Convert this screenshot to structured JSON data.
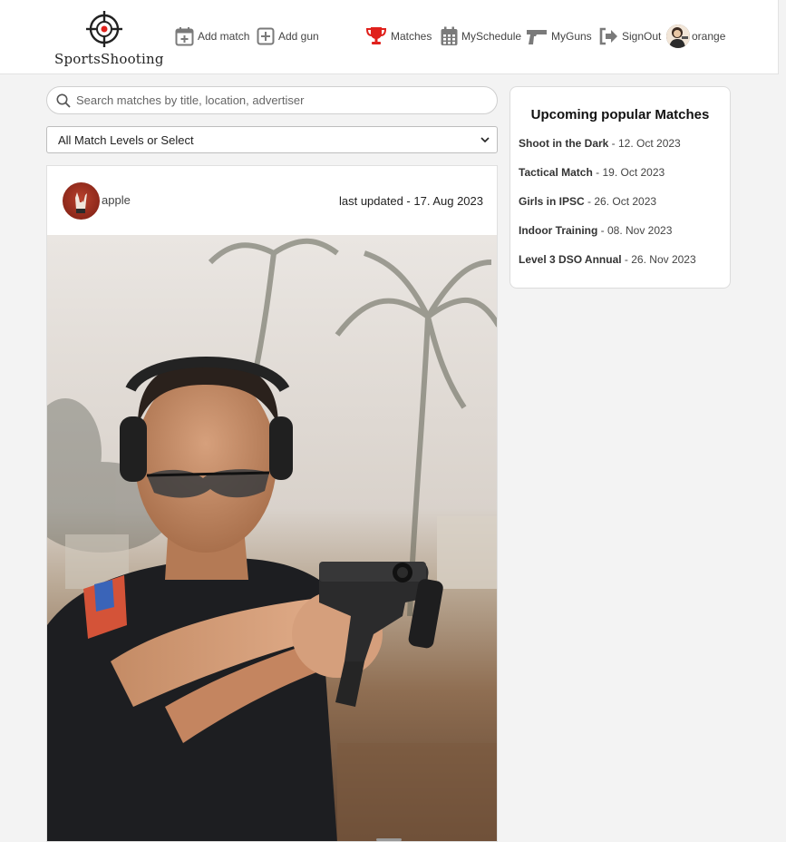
{
  "brand": {
    "name": "SportsShooting",
    "icon": "crosshair-logo"
  },
  "nav": {
    "add_match": "Add match",
    "add_gun": "Add gun",
    "matches": "Matches",
    "schedule": "MySchedule",
    "guns": "MyGuns",
    "signout": "SignOut",
    "user": "orange"
  },
  "search": {
    "placeholder": "Search matches by title, location, advertiser",
    "value": ""
  },
  "filter": {
    "selected": "All Match Levels or Select"
  },
  "post": {
    "user": "apple",
    "updated": "last updated - 17. Aug 2023"
  },
  "popular": {
    "title": "Upcoming popular Matches",
    "items": [
      {
        "name": "Shoot in the Dark",
        "date": " - 12. Oct 2023"
      },
      {
        "name": "Tactical Match",
        "date": " - 19. Oct 2023"
      },
      {
        "name": "Girls in IPSC",
        "date": " - 26. Oct 2023"
      },
      {
        "name": "Indoor Training",
        "date": " - 08. Nov 2023"
      },
      {
        "name": "Level 3 DSO Annual",
        "date": " - 26. Nov 2023"
      }
    ]
  },
  "colors": {
    "accent_red": "#e0211c",
    "icon_gray": "#7a7a7a",
    "background": "#f3f3f3"
  }
}
